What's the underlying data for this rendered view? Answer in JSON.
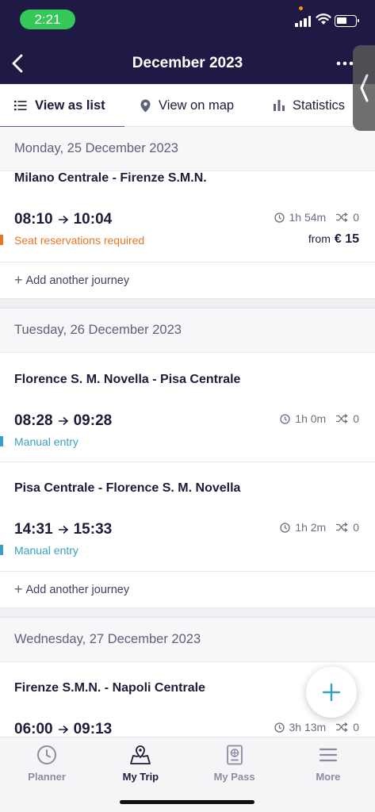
{
  "status_bar": {
    "time": "2:21"
  },
  "header": {
    "title": "December 2023"
  },
  "tabs": [
    {
      "label": "View as list",
      "icon": "list-icon",
      "active": true
    },
    {
      "label": "View on map",
      "icon": "map-pin-icon",
      "active": false
    },
    {
      "label": "Statistics",
      "icon": "bar-chart-icon",
      "active": false
    }
  ],
  "days": [
    {
      "date": "Monday, 25 December 2023",
      "journeys": [
        {
          "route": "Milano Centrale - Firenze S.M.N.",
          "depart": "08:10",
          "arrive": "10:04",
          "duration": "1h 54m",
          "changes": "0",
          "note": "Seat reservations required",
          "note_color": "#e87722",
          "price_prefix": "from",
          "price": "€ 15"
        }
      ],
      "add_label": "Add another journey"
    },
    {
      "date": "Tuesday, 26 December 2023",
      "journeys": [
        {
          "route": "Florence S. M. Novella - Pisa Centrale",
          "depart": "08:28",
          "arrive": "09:28",
          "duration": "1h 0m",
          "changes": "0",
          "note": "Manual entry",
          "note_color": "#3a9fc4"
        },
        {
          "route": "Pisa Centrale - Florence S. M. Novella",
          "depart": "14:31",
          "arrive": "15:33",
          "duration": "1h 2m",
          "changes": "0",
          "note": "Manual entry",
          "note_color": "#3a9fc4"
        }
      ],
      "add_label": "Add another journey"
    },
    {
      "date": "Wednesday, 27 December 2023",
      "journeys": [
        {
          "route": "Firenze S.M.N. - Napoli Centrale",
          "depart": "06:00",
          "arrive": "09:13",
          "duration": "3h 13m",
          "changes": "0"
        }
      ]
    }
  ],
  "bottom_nav": [
    {
      "label": "Planner",
      "icon": "clock-icon",
      "active": false
    },
    {
      "label": "My Trip",
      "icon": "trip-map-icon",
      "active": true
    },
    {
      "label": "My Pass",
      "icon": "passport-icon",
      "active": false
    },
    {
      "label": "More",
      "icon": "menu-icon",
      "active": false
    }
  ],
  "colors": {
    "header_bg": "#1e1a44",
    "accent": "#3a9fc4",
    "warning": "#e87722"
  }
}
